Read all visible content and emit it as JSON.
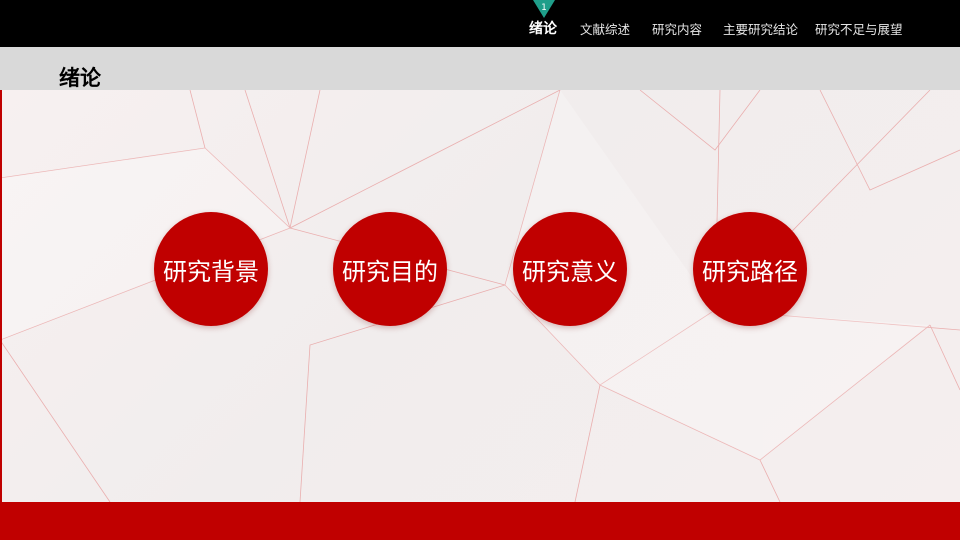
{
  "nav": {
    "marker_number": "1",
    "items": [
      {
        "label": "绪论",
        "active": true
      },
      {
        "label": "文献综述",
        "active": false
      },
      {
        "label": "研究内容",
        "active": false
      },
      {
        "label": "主要研究结论",
        "active": false
      },
      {
        "label": "研究不足与展望",
        "active": false
      }
    ]
  },
  "page_title": "绪论",
  "circles": [
    {
      "label": "研究背景"
    },
    {
      "label": "研究目的"
    },
    {
      "label": "研究意义"
    },
    {
      "label": "研究路径"
    }
  ],
  "colors": {
    "accent_red": "#c00000",
    "marker_teal": "#1f9e8a",
    "topbar": "#000000",
    "title_band": "#d9d9d9"
  }
}
